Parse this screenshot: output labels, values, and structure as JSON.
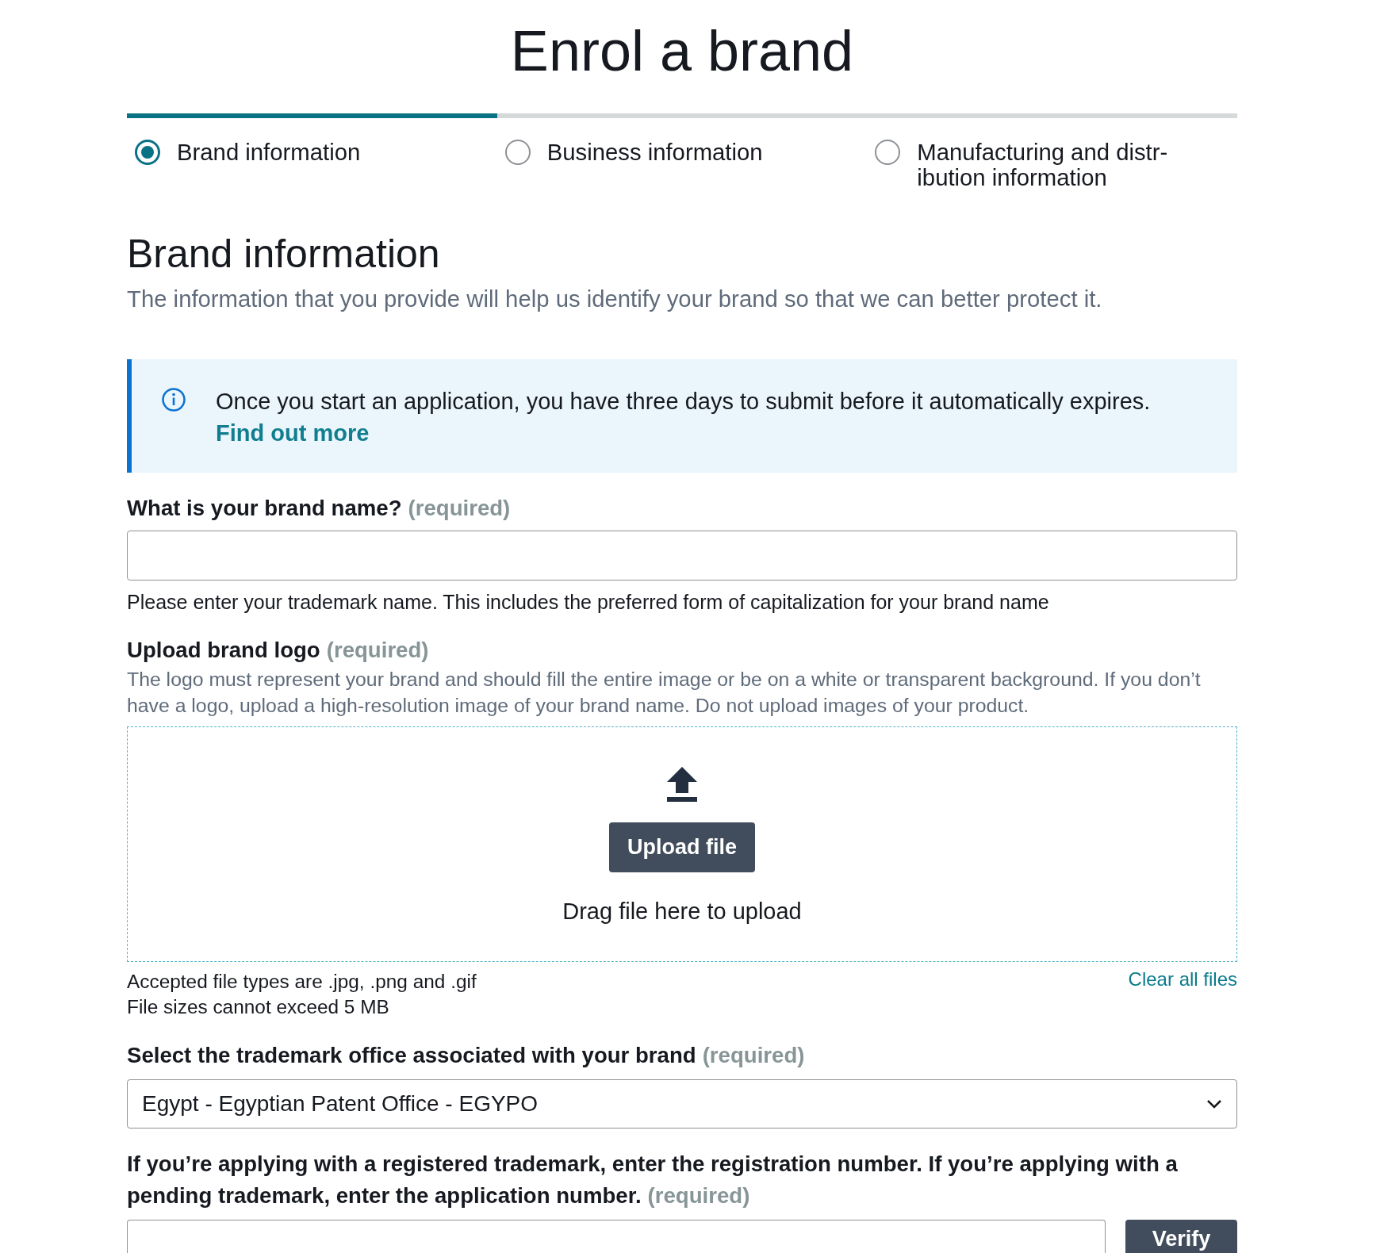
{
  "page": {
    "title": "Enrol a brand"
  },
  "progress": {
    "level": 0.3333
  },
  "steps": [
    {
      "label": "Brand information",
      "selected": true
    },
    {
      "label": "Business information",
      "selected": false
    },
    {
      "label": "Manufacturing and distr-ibution information",
      "selected": false
    }
  ],
  "section": {
    "title": "Brand information",
    "description": "The information that you provide will help us identify your brand so that we can better protect it."
  },
  "notice": {
    "text": "Once you start an application, you have three days to submit before it automatically expires.",
    "link": "Find out more"
  },
  "fields": [
    {
      "kind": "text",
      "label": "What is your brand name?",
      "required": "(required)",
      "hint": "Please enter your trademark name. This includes the preferred form of capitalization for your brand name"
    },
    {
      "kind": "upload",
      "label": "Upload brand logo",
      "required": "(required)",
      "description": "The logo must represent your brand and should fill the entire image or be on a white or transparent background. If you don’t have a logo, upload a high-resolution image of your brand name. Do not upload images of your product.",
      "button": "Upload file",
      "drop_text": "Drag file here to upload",
      "notes": [
        "Accepted file types are .jpg, .png and .gif",
        "File sizes cannot exceed 5 MB"
      ],
      "clear_link": "Clear all files"
    },
    {
      "kind": "select",
      "label": "Select the trademark office associated with your brand",
      "required": "(required)",
      "value": "Egypt - Egyptian Patent Office - EGYPO"
    },
    {
      "kind": "text_with_button",
      "label": "If you’re applying with a registered trademark, enter the registration number. If you’re applying with a pending trademark, enter the application number.",
      "required": "(required)",
      "button": "Verify"
    }
  ]
}
